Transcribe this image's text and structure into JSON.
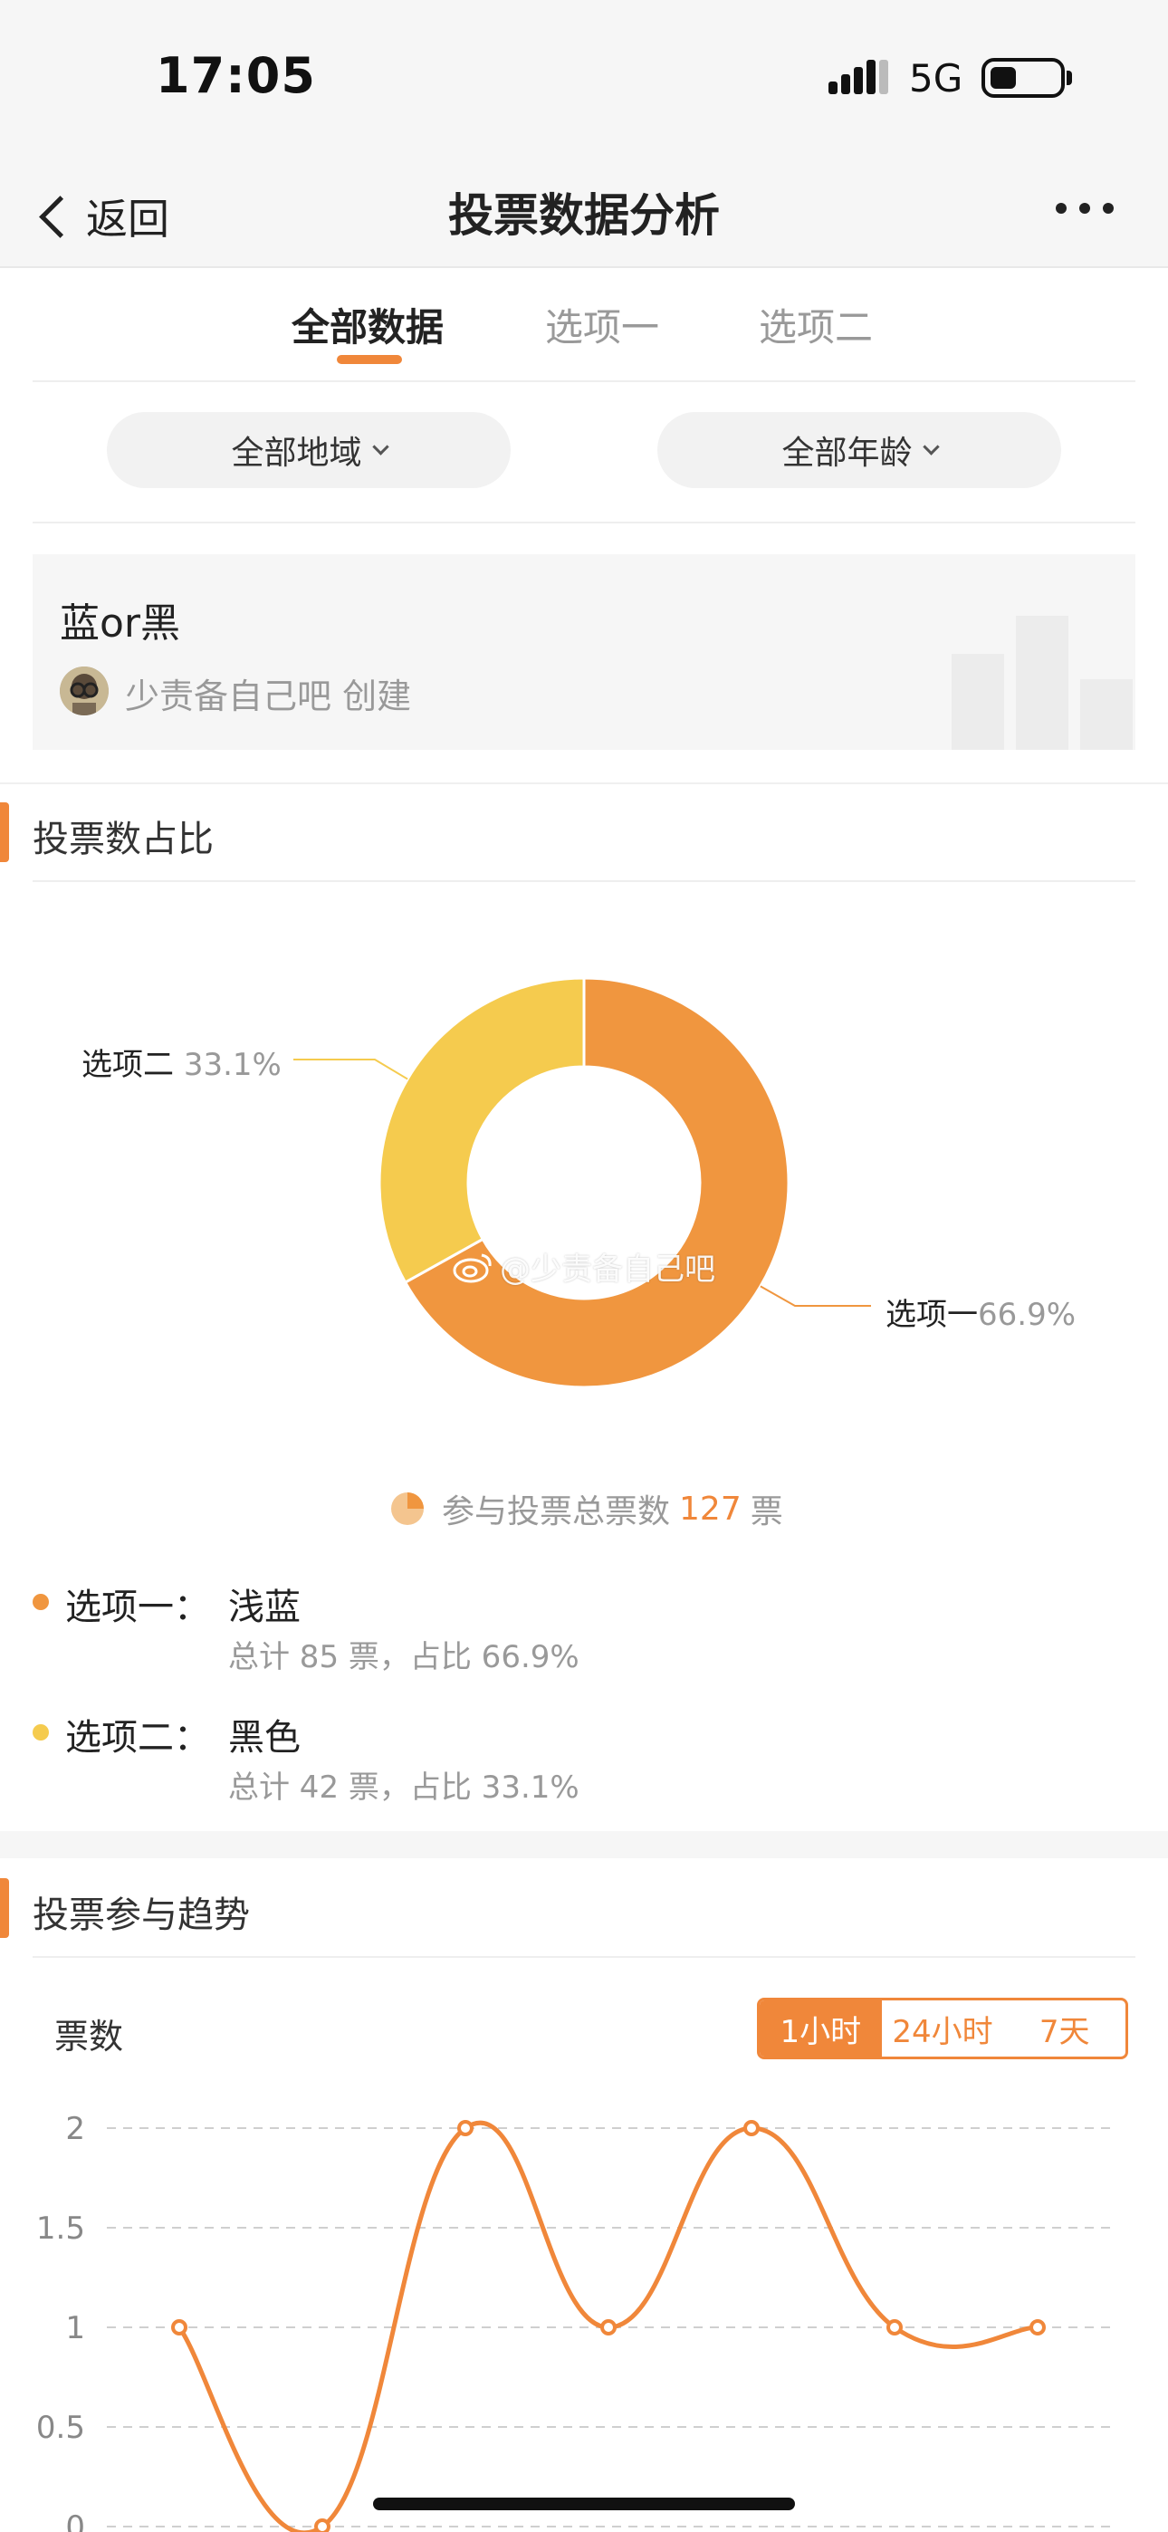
{
  "status_bar": {
    "time": "17:05",
    "network": "5G",
    "icons": [
      "signal-icon",
      "battery-icon"
    ]
  },
  "nav": {
    "back_label": "返回",
    "title": "投票数据分析",
    "more_icon": "more-icon"
  },
  "tabs": [
    {
      "label": "全部数据",
      "active": true
    },
    {
      "label": "选项一",
      "active": false
    },
    {
      "label": "选项二",
      "active": false
    }
  ],
  "filters": {
    "region": "全部地域",
    "age": "全部年龄"
  },
  "vote": {
    "title": "蓝or黑",
    "creator": "少责备自己吧 创建"
  },
  "share_section": {
    "title": "投票数占比",
    "total_prefix": "参与投票总票数",
    "total_value": "127",
    "total_suffix": "票",
    "watermark": "@少责备自己吧",
    "labels": {
      "opt2_name": "选项二",
      "opt2_pct": "33.1%",
      "opt1_name": "选项一",
      "opt1_pct": "66.9%"
    },
    "options": [
      {
        "label": "选项一：",
        "value": "浅蓝",
        "detail": "总计 85 票，占比 66.9%",
        "color": "#f0963f"
      },
      {
        "label": "选项二：",
        "value": "黑色",
        "detail": "总计 42 票，占比 33.1%",
        "color": "#f5cb4e"
      }
    ]
  },
  "trend_section": {
    "title": "投票参与趋势",
    "y_label": "票数",
    "ranges": [
      {
        "label": "1小时",
        "active": true
      },
      {
        "label": "24小时",
        "active": false
      },
      {
        "label": "7天",
        "active": false
      }
    ]
  },
  "chart_data": [
    {
      "type": "pie",
      "labels": [
        "选项一",
        "选项二"
      ],
      "values": [
        66.9,
        33.1
      ],
      "colors": [
        "#f0963f",
        "#f5cb4e"
      ]
    },
    {
      "type": "line",
      "x": [
        1,
        2,
        3,
        4,
        5,
        6,
        7
      ],
      "values": [
        1,
        0,
        2,
        1,
        2,
        1,
        1
      ],
      "y_ticks": [
        "2",
        "1.5",
        "1",
        "0.5",
        "0"
      ],
      "ylim": [
        0,
        2
      ],
      "grid": true,
      "color": "#f0873a"
    }
  ]
}
